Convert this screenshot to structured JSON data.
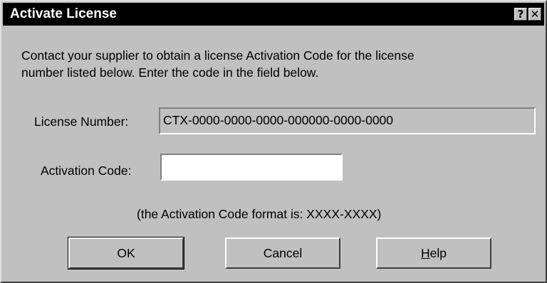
{
  "window": {
    "title": "Activate License",
    "help_glyph": "?",
    "close_glyph": "✕"
  },
  "instructions": "Contact your supplier to obtain a license Activation Code for the license\nnumber listed below.  Enter the code in the field below.",
  "license": {
    "label": "License Number:",
    "value": "CTX-0000-0000-0000-000000-0000-0000"
  },
  "activation": {
    "label": "Activation Code:",
    "value": ""
  },
  "hint": "(the Activation Code format is: XXXX-XXXX)",
  "buttons": {
    "ok": "OK",
    "cancel": "Cancel",
    "help_mnemonic": "H",
    "help_rest": "elp"
  },
  "colors": {
    "dialog_face": "#c0c0c0",
    "titlebar": "#000000",
    "title_text": "#ffffff"
  }
}
